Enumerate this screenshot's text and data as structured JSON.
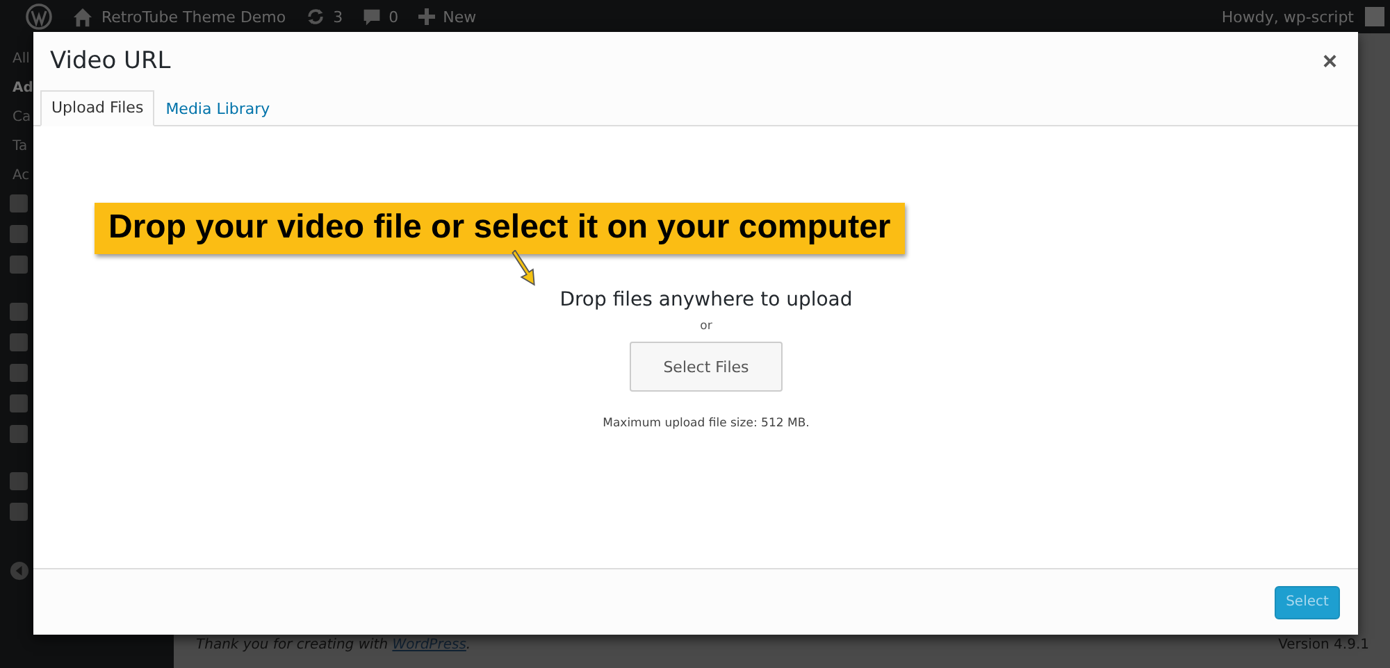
{
  "admin_bar": {
    "site_name": "RetroTube Theme Demo",
    "updates": "3",
    "comments": "0",
    "new": "New",
    "greeting": "Howdy, wp-script"
  },
  "sidebar": {
    "items": [
      "All",
      "Ad",
      "Ca",
      "Ta",
      "Ac"
    ]
  },
  "modal": {
    "title": "Video URL",
    "close": "×",
    "tabs": [
      {
        "label": "Upload Files",
        "selected": true
      },
      {
        "label": "Media Library",
        "selected": false
      }
    ],
    "callout": "Drop your video file or select it on your computer",
    "drop_text": "Drop files anywhere to upload",
    "or": "or",
    "select_button": "Select Files",
    "max_size": "Maximum upload file size: 512 MB.",
    "footer_button": {
      "label": "Select",
      "disabled": true
    }
  },
  "footer": {
    "thanks": "Thank you for creating with",
    "thanks_link": "WordPress",
    "thanks_end": ".",
    "version": "Version 4.9.1"
  }
}
